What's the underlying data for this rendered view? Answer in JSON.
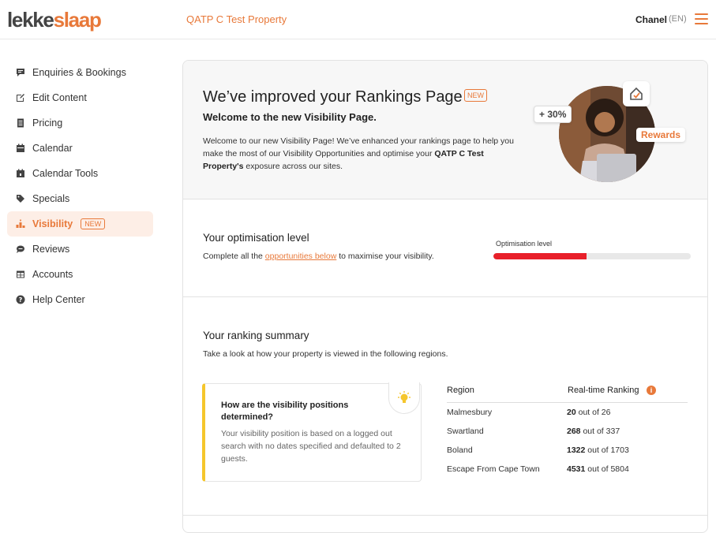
{
  "header": {
    "logo_part1": "lekke",
    "logo_part2": "slaap",
    "property_name": "QATP C Test Property",
    "user_name": "Chanel",
    "language": "(EN)"
  },
  "sidebar": {
    "items": [
      {
        "label": "Enquiries & Bookings",
        "icon": "chat-icon"
      },
      {
        "label": "Edit Content",
        "icon": "edit-icon"
      },
      {
        "label": "Pricing",
        "icon": "document-icon"
      },
      {
        "label": "Calendar",
        "icon": "calendar-icon"
      },
      {
        "label": "Calendar Tools",
        "icon": "calendar-tools-icon"
      },
      {
        "label": "Specials",
        "icon": "tag-icon"
      },
      {
        "label": "Visibility",
        "icon": "podium-icon",
        "badge": "NEW",
        "active": true
      },
      {
        "label": "Reviews",
        "icon": "comment-icon"
      },
      {
        "label": "Accounts",
        "icon": "table-icon"
      },
      {
        "label": "Help Center",
        "icon": "help-icon"
      }
    ]
  },
  "hero": {
    "title": "We’ve improved your Rankings Page",
    "badge": "NEW",
    "subtitle": "Welcome to the new Visibility Page.",
    "text_before": "Welcome to our new Visibility Page! We’ve enhanced your rankings page to help you make the most of our Visibility Opportunities and optimise your ",
    "text_bold": "QATP C Test Property's",
    "text_after": " exposure across our sites.",
    "percent_chip": "+ 30%",
    "rewards_chip": "Rewards"
  },
  "optimisation": {
    "title": "Your optimisation level",
    "text_before": "Complete all the ",
    "link_text": "opportunities below",
    "text_after": " to maximise your visibility.",
    "bar_label": "Optimisation level",
    "level_fraction": 0.47
  },
  "ranking": {
    "title": "Your ranking summary",
    "subtitle": "Take a look at how your property is viewed in the following regions.",
    "info_title": "How are the visibility positions determined?",
    "info_text": "Your visibility position is based on a logged out search with no dates specified and defaulted to 2 guests.",
    "col_region": "Region",
    "col_ranking": "Real-time Ranking",
    "info_icon": "i",
    "rows": [
      {
        "region": "Malmesbury",
        "rank": "20",
        "total": "out of 26"
      },
      {
        "region": "Swartland",
        "rank": "268",
        "total": "out of 337"
      },
      {
        "region": "Boland",
        "rank": "1322",
        "total": "out of 1703"
      },
      {
        "region": "Escape From Cape Town",
        "rank": "4531",
        "total": "out of 5804"
      }
    ]
  },
  "colors": {
    "accent": "#e8793a",
    "progress": "#e8202a",
    "info_border": "#f5c62c"
  }
}
